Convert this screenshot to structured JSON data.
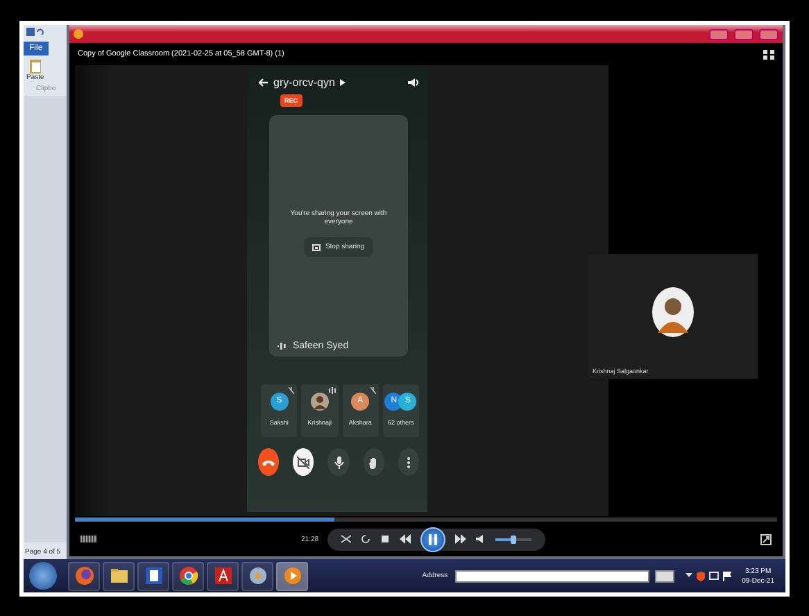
{
  "word": {
    "tab": "File",
    "paste": "Paste",
    "group": "Clipbo",
    "status": "Page 4 of 5"
  },
  "player": {
    "title": "Copy of Google Classroom  (2021-02-25 at 05_58 GMT-8) (1)",
    "time": "21:28",
    "playing": true,
    "seek": {
      "level": 0.37
    },
    "volume": {
      "level": 0.5
    }
  },
  "meet": {
    "meeting": "gry-orcv-qyn",
    "rec": "REC",
    "share_text": "You're sharing your screen with everyone",
    "stop": "Stop sharing",
    "presenter": "Safeen Syed",
    "tiles": [
      {
        "kind": "initial",
        "name": "Sakshi",
        "muted": true,
        "speaking": false,
        "avatars": [
          {
            "initial": "S",
            "color": "#2a9fd6"
          }
        ]
      },
      {
        "kind": "photo",
        "name": "Krishnaji",
        "muted": false,
        "speaking": true
      },
      {
        "kind": "initial",
        "name": "Akshara",
        "muted": true,
        "speaking": false,
        "avatars": [
          {
            "initial": "A",
            "color": "#d98a5b"
          }
        ]
      },
      {
        "kind": "group",
        "name": "62 others",
        "muted": false,
        "speaking": false,
        "avatars": [
          {
            "initial": "N",
            "color": "#1e7fd8"
          },
          {
            "initial": "S",
            "color": "#29b0d8"
          }
        ]
      }
    ],
    "side_tile": {
      "name": "Krishnaj Salgaonkar"
    }
  },
  "taskbar": {
    "apps": [
      {
        "kind": "firefox",
        "selected": false
      },
      {
        "kind": "folder",
        "selected": false
      },
      {
        "kind": "word",
        "selected": false
      },
      {
        "kind": "chrome",
        "selected": false
      },
      {
        "kind": "pdf",
        "selected": false
      },
      {
        "kind": "disc",
        "selected": false
      },
      {
        "kind": "player",
        "selected": true
      }
    ],
    "address_label": "Address",
    "clock_time": "3:23 PM",
    "clock_date": "09-Dec-21"
  }
}
